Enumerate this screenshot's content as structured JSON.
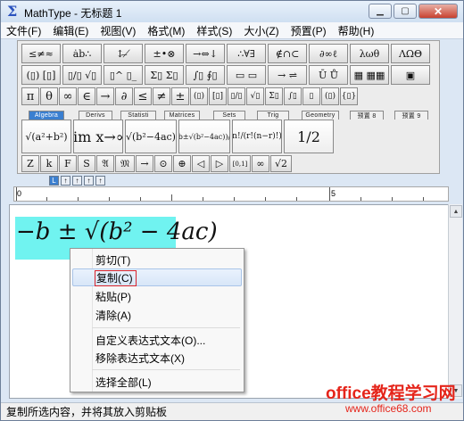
{
  "titlebar": {
    "icon": "Σ",
    "title": "MathType - 无标题 1",
    "minimize": "▁",
    "maximize": "▢",
    "close": "✕"
  },
  "menu": [
    "文件(F)",
    "编辑(E)",
    "视图(V)",
    "格式(M)",
    "样式(S)",
    "大小(Z)",
    "预置(P)",
    "帮助(H)"
  ],
  "palette_row1": [
    "≤≠≈",
    "ȧb∴",
    "↕ ̶ ̸",
    "±•⊗",
    "→⇔↓",
    "∴∀∃",
    "∉∩⊂",
    "∂∞ℓ",
    "λωθ",
    "ΛΩΘ"
  ],
  "palette_row2": [
    "(▯) [▯]",
    "▯/▯ √▯",
    "▯^ ▯_",
    "Σ▯ Σ▯",
    "∫▯ ∮▯",
    "▭ ▭",
    "→ ⇌",
    "Ū Ů",
    "▦ ▦▦",
    "▣"
  ],
  "symbols": [
    "π",
    "θ",
    "∞",
    "∈",
    "→",
    "∂",
    "≤",
    "≠",
    "±",
    "(▯)",
    "[▯]",
    "▯/▯",
    "√▯",
    "Σ▯",
    "∫▯",
    "▯",
    "(▯)",
    "{▯}"
  ],
  "tabs": [
    "Algebra",
    "Derivs",
    "Statisti",
    "Matrices",
    "Sets",
    "Trig",
    "Geometry",
    "预置 8",
    "预置 9"
  ],
  "templates": [
    "√(a²+b²)",
    "lim x→∞",
    "√(b²−4ac)",
    "(−b±√(b²−4ac))/2a",
    "n!/(r!(n−r)!)",
    "1/2"
  ],
  "row_small": [
    "Z",
    "k",
    "F",
    "S",
    "𝔄",
    "𝔐",
    "→",
    "⊙",
    "⊕",
    "◁",
    "▷",
    "[0,1]",
    "∞",
    "√2"
  ],
  "size_buttons": [
    "L",
    "↑",
    "↑",
    "↑",
    "↑"
  ],
  "ruler": {
    "left": "0",
    "mid": "5"
  },
  "equation": "−b ± √(b² − 4ac)",
  "context_menu": {
    "items": [
      "剪切(T)",
      "复制(C)",
      "粘贴(P)",
      "清除(A)",
      "自定义表达式文本(O)...",
      "移除表达式文本(X)",
      "选择全部(L)"
    ]
  },
  "status": "复制所选内容，并将其放入剪贴板",
  "watermark": {
    "line1": "office教程学习网",
    "line2": "www.office68.com"
  }
}
